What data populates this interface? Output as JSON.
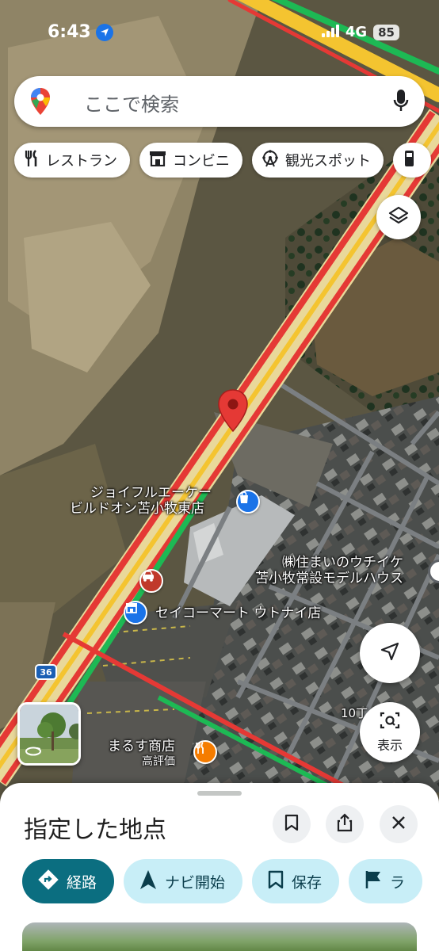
{
  "status_bar": {
    "time": "6:43",
    "network": "4G",
    "battery": "85"
  },
  "search": {
    "placeholder": "ここで検索"
  },
  "chips": [
    {
      "label": "レストラン",
      "icon": "fork-knife-icon"
    },
    {
      "label": "コンビニ",
      "icon": "store-icon"
    },
    {
      "label": "観光スポット",
      "icon": "ferris-wheel-icon"
    }
  ],
  "map": {
    "road_shield": "36",
    "labels": {
      "joyful_1": "ジョイフルエーケー",
      "joyful_2": "ビルドオン苫小牧東店",
      "house_1": "㈱住まいのウチイケ",
      "house_2": "苫小牧常設モデルハウス",
      "seicomart": "セイコーマート ウトナイ店",
      "marusu": "まるす商店",
      "marusu_sub": "高評価",
      "district": "10丁"
    }
  },
  "buttons": {
    "display_label": "表示"
  },
  "sheet": {
    "title": "指定した地点",
    "actions": [
      {
        "label": "経路",
        "icon": "directions-icon"
      },
      {
        "label": "ナビ開始",
        "icon": "navigation-arrow-icon"
      },
      {
        "label": "保存",
        "icon": "bookmark-icon"
      },
      {
        "label": "ラ",
        "icon": "flag-icon"
      }
    ]
  },
  "colors": {
    "accent": "#0b6e80",
    "action_bg": "#c8eef7",
    "pin_red": "#e53935",
    "traffic_red": "#e53935",
    "traffic_yellow": "#f4c430",
    "traffic_green": "#1db954",
    "poi_blue": "#1a73e8",
    "poi_orange": "#f57c00",
    "poi_red": "#c0392b"
  }
}
